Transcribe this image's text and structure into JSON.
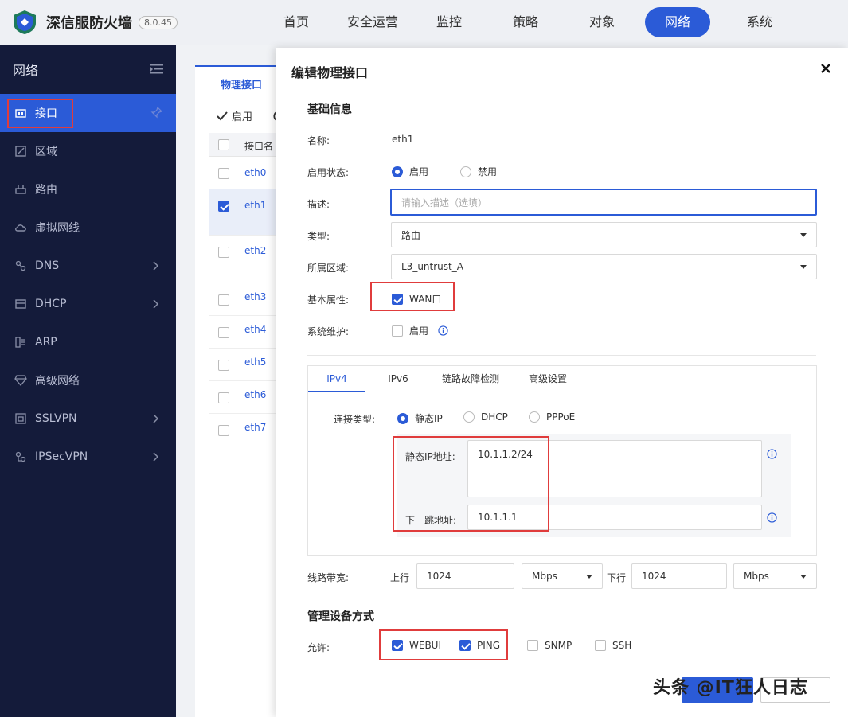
{
  "app": {
    "title": "深信服防火墙",
    "version": "8.0.45"
  },
  "nav": [
    "首页",
    "安全运营",
    "监控",
    "策略",
    "对象",
    "网络",
    "系统"
  ],
  "nav_active": "网络",
  "sidebar": {
    "title": "网络",
    "items": [
      {
        "label": "接口",
        "icon": "interface-icon",
        "active": true
      },
      {
        "label": "区域",
        "icon": "zone-icon"
      },
      {
        "label": "路由",
        "icon": "route-icon"
      },
      {
        "label": "虚拟网线",
        "icon": "cloud-icon"
      },
      {
        "label": "DNS",
        "icon": "dns-icon",
        "expandable": true
      },
      {
        "label": "DHCP",
        "icon": "dhcp-icon",
        "expandable": true
      },
      {
        "label": "ARP",
        "icon": "arp-icon"
      },
      {
        "label": "高级网络",
        "icon": "diamond-icon"
      },
      {
        "label": "SSLVPN",
        "icon": "sslvpn-icon",
        "expandable": true
      },
      {
        "label": "IPSecVPN",
        "icon": "ipsecvpn-icon",
        "expandable": true
      }
    ]
  },
  "background": {
    "tab": "物理接口",
    "toolbar_enable": "启用",
    "table_header": "接口名",
    "rows": [
      "eth0",
      "eth1",
      "eth2",
      "eth3",
      "eth4",
      "eth5",
      "eth6",
      "eth7"
    ]
  },
  "modal": {
    "title": "编辑物理接口",
    "basic_section": "基础信息",
    "name_label": "名称:",
    "name_value": "eth1",
    "status_label": "启用状态:",
    "status_on": "启用",
    "status_off": "禁用",
    "desc_label": "描述:",
    "desc_placeholder": "请输入描述（选填）",
    "type_label": "类型:",
    "type_value": "路由",
    "zone_label": "所属区域:",
    "zone_value": "L3_untrust_A",
    "attr_label": "基本属性:",
    "attr_wan": "WAN口",
    "maint_label": "系统维护:",
    "maint_enable": "启用",
    "tabs": [
      "IPv4",
      "IPv6",
      "链路故障检测",
      "高级设置"
    ],
    "conn_label": "连接类型:",
    "conn_opts": [
      "静态IP",
      "DHCP",
      "PPPoE"
    ],
    "static_ip_label": "静态IP地址:",
    "static_ip_value": "10.1.1.2/24",
    "gateway_label": "下一跳地址:",
    "gateway_value": "10.1.1.1",
    "bw_label": "线路带宽:",
    "bw_up_label": "上行",
    "bw_up_value": "1024",
    "bw_up_unit": "Mbps",
    "bw_down_label": "下行",
    "bw_down_value": "1024",
    "bw_down_unit": "Mbps",
    "mgmt_section": "管理设备方式",
    "allow_label": "允许:",
    "allow_opts": [
      {
        "label": "WEBUI",
        "checked": true
      },
      {
        "label": "PING",
        "checked": true
      },
      {
        "label": "SNMP",
        "checked": false
      },
      {
        "label": "SSH",
        "checked": false
      }
    ]
  },
  "watermark": "头条 @IT狂人日志",
  "colors": {
    "accent": "#2b5bd7",
    "sidebar": "#141b3a",
    "highlight": "#e03c3c"
  }
}
